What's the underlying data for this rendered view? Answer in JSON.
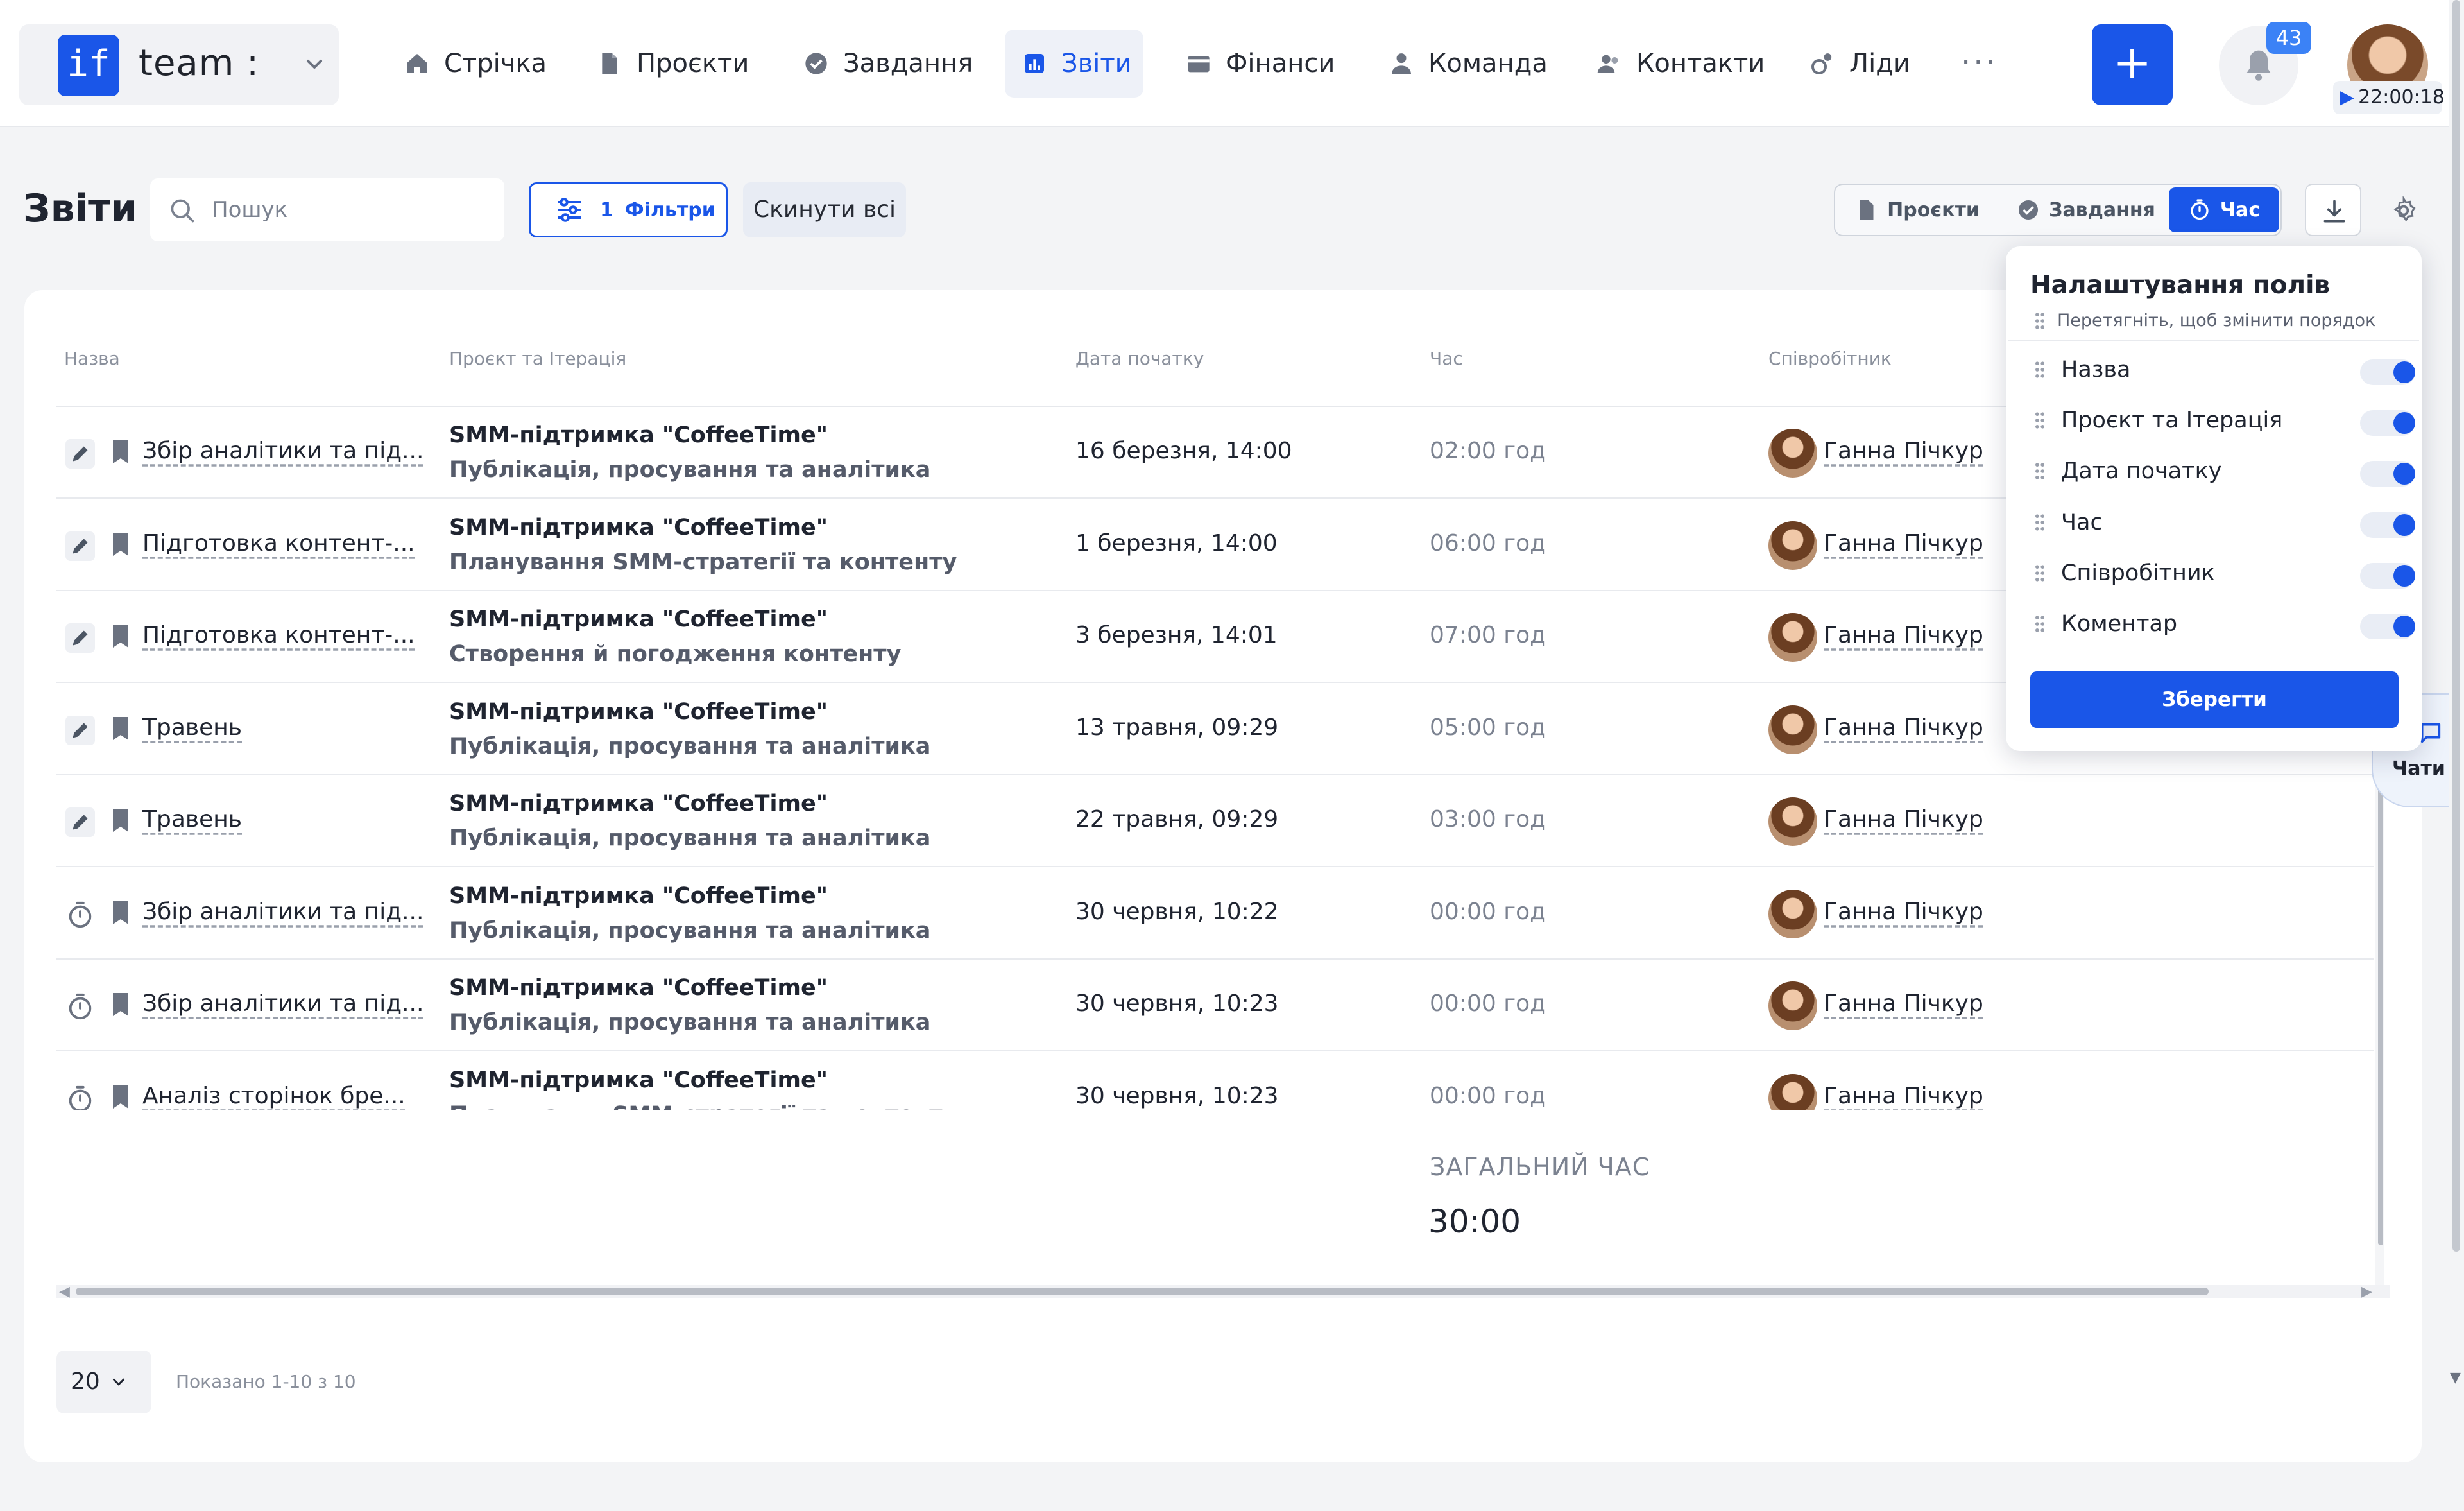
{
  "brand": {
    "logo": "if",
    "name": "team :"
  },
  "nav": [
    {
      "label": "Стрічка",
      "icon": "home-icon"
    },
    {
      "label": "Проєкти",
      "icon": "document-icon"
    },
    {
      "label": "Завдання",
      "icon": "check-circle-icon"
    },
    {
      "label": "Звіти",
      "icon": "chart-icon"
    },
    {
      "label": "Фінанси",
      "icon": "wallet-icon"
    },
    {
      "label": "Команда",
      "icon": "user-icon"
    },
    {
      "label": "Контакти",
      "icon": "contacts-icon"
    },
    {
      "label": "Ліди",
      "icon": "leads-icon"
    }
  ],
  "header": {
    "more": "···",
    "add": "+",
    "notifications_count": "43",
    "timer": "22:00:18"
  },
  "toolbar": {
    "title": "Звіти",
    "search_placeholder": "Пошук",
    "filters_count": "1",
    "filters_label": "Фільтри",
    "reset_label": "Скинути всі",
    "views": [
      {
        "label": "Проєкти",
        "icon": "document-icon"
      },
      {
        "label": "Завдання",
        "icon": "check-circle-icon"
      },
      {
        "label": "Час",
        "icon": "stopwatch-icon"
      }
    ]
  },
  "table": {
    "columns": [
      "Назва",
      "Проєкт та Ітерація",
      "Дата початку",
      "Час",
      "Співробітник"
    ],
    "rows": [
      {
        "icon": "pencil-icon",
        "name": "Збір аналітики та під...",
        "project": "SMM-підтримка \"CoffeeTime\"",
        "iteration": "Публікація, просування та аналітика",
        "date": "16 березня, 14:00",
        "time": "02:00 год",
        "employee": "Ганна Пічкур"
      },
      {
        "icon": "pencil-icon",
        "name": "Підготовка контент-...",
        "project": "SMM-підтримка \"CoffeeTime\"",
        "iteration": "Планування SMM-стратегії та контенту",
        "date": "1 березня, 14:00",
        "time": "06:00 год",
        "employee": "Ганна Пічкур"
      },
      {
        "icon": "pencil-icon",
        "name": "Підготовка контент-...",
        "project": "SMM-підтримка \"CoffeeTime\"",
        "iteration": "Створення й погодження контенту",
        "date": "3 березня, 14:01",
        "time": "07:00 год",
        "employee": "Ганна Пічкур"
      },
      {
        "icon": "pencil-icon",
        "name": "Травень",
        "project": "SMM-підтримка \"CoffeeTime\"",
        "iteration": "Публікація, просування та аналітика",
        "date": "13 травня, 09:29",
        "time": "05:00 год",
        "employee": "Ганна Пічкур"
      },
      {
        "icon": "pencil-icon",
        "name": "Травень",
        "project": "SMM-підтримка \"CoffeeTime\"",
        "iteration": "Публікація, просування та аналітика",
        "date": "22 травня, 09:29",
        "time": "03:00 год",
        "employee": "Ганна Пічкур"
      },
      {
        "icon": "stopwatch-icon",
        "name": "Збір аналітики та під...",
        "project": "SMM-підтримка \"CoffeeTime\"",
        "iteration": "Публікація, просування та аналітика",
        "date": "30 червня, 10:22",
        "time": "00:00 год",
        "employee": "Ганна Пічкур"
      },
      {
        "icon": "stopwatch-icon",
        "name": "Збір аналітики та під...",
        "project": "SMM-підтримка \"CoffeeTime\"",
        "iteration": "Публікація, просування та аналітика",
        "date": "30 червня, 10:23",
        "time": "00:00 год",
        "employee": "Ганна Пічкур"
      },
      {
        "icon": "stopwatch-icon",
        "name": "Аналіз сторінок бре...",
        "project": "SMM-підтримка \"CoffeeTime\"",
        "iteration": "Планування SMM-стратегії та контенту",
        "date": "30 червня, 10:23",
        "time": "00:00 год",
        "employee": "Ганна Пічкур"
      }
    ],
    "total_label": "ЗАГАЛЬНИЙ ЧАС",
    "total_value": "30:00"
  },
  "pagination": {
    "page_size": "20",
    "shown": "Показано 1-10 з 10"
  },
  "chat": {
    "label": "Чати"
  },
  "fields_panel": {
    "title": "Налаштування полів",
    "hint": "Перетягніть, щоб змінити порядок",
    "fields": [
      {
        "label": "Назва",
        "enabled": true
      },
      {
        "label": "Проєкт та Ітерація",
        "enabled": true
      },
      {
        "label": "Дата початку",
        "enabled": true
      },
      {
        "label": "Час",
        "enabled": true
      },
      {
        "label": "Співробітник",
        "enabled": true
      },
      {
        "label": "Коментар",
        "enabled": true
      }
    ],
    "save_label": "Зберегти"
  },
  "colors": {
    "accent": "#1a56e8",
    "badge": "#3b82f6",
    "background": "#f3f4f6"
  }
}
